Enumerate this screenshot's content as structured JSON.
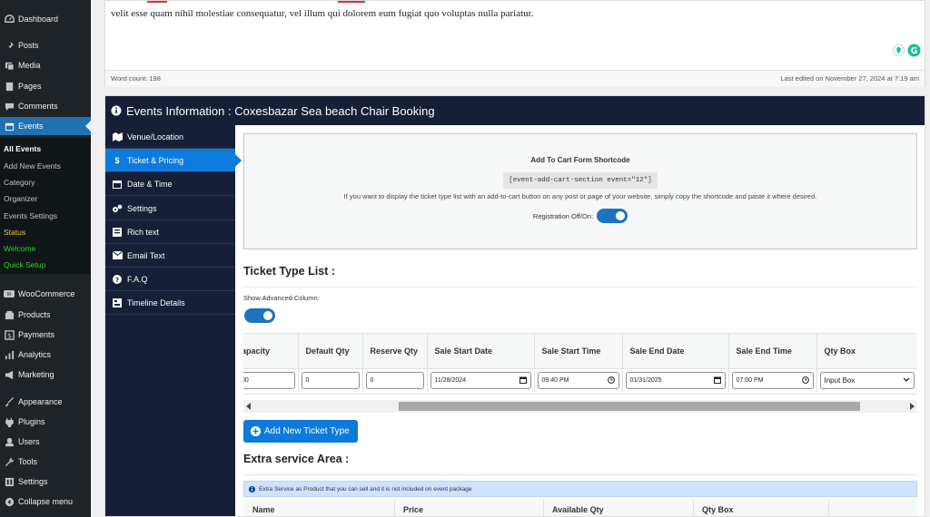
{
  "sidebar": {
    "items": [
      {
        "label": "Dashboard",
        "icon": "dashboard-icon"
      },
      {
        "label": "Posts",
        "icon": "pin-icon"
      },
      {
        "label": "Media",
        "icon": "media-icon"
      },
      {
        "label": "Pages",
        "icon": "pages-icon"
      },
      {
        "label": "Comments",
        "icon": "comments-icon"
      },
      {
        "label": "Events",
        "icon": "calendar-icon"
      },
      {
        "label": "WooCommerce",
        "icon": "woo-icon"
      },
      {
        "label": "Products",
        "icon": "products-icon"
      },
      {
        "label": "Payments",
        "icon": "payments-icon"
      },
      {
        "label": "Analytics",
        "icon": "analytics-icon"
      },
      {
        "label": "Marketing",
        "icon": "marketing-icon"
      },
      {
        "label": "Appearance",
        "icon": "brush-icon"
      },
      {
        "label": "Plugins",
        "icon": "plugin-icon"
      },
      {
        "label": "Users",
        "icon": "users-icon"
      },
      {
        "label": "Tools",
        "icon": "wrench-icon"
      },
      {
        "label": "Settings",
        "icon": "settings-icon"
      },
      {
        "label": "Collapse menu",
        "icon": "collapse-icon"
      }
    ],
    "events_submenu": [
      "All Events",
      "Add New Events",
      "Category",
      "Organizer",
      "Events Settings",
      "Status",
      "Welcome",
      "Quick Setup"
    ]
  },
  "editor": {
    "text": "velit esse quam nihil molestiae consequatur, vel illum qui dolorem eum fugiat quo voluptas nulla pariatur.",
    "word_count": "Word count: 198",
    "last_edited": "Last edited on November 27, 2024 at 7:19 am"
  },
  "events_box": {
    "title": "Events Information : Coxesbazar Sea beach Chair Booking",
    "tabs": [
      "Venue/Location",
      "Ticket & Pricing",
      "Date & Time",
      "Settings",
      "Rich text",
      "Email Text",
      "F.A.Q",
      "Timeline Details"
    ],
    "shortcode": {
      "heading": "Add To Cart Form Shortcode",
      "code": "[event-add-cart-section event=\"12\"]",
      "help": "If you want to display the ticket type list with an add-to-cart button on any post or page of your website, simply copy the shortcode and paste it where desired.",
      "registration_label": "Registration Off/On:"
    },
    "ticket_type": {
      "heading": "Ticket Type List :",
      "advanced_label": "Show Advanced Column:",
      "columns": [
        "apacity",
        "Default Qty",
        "Reserve Qty",
        "Sale Start Date",
        "Sale Start Time",
        "Sale End Date",
        "Sale End Time",
        "Qty Box"
      ],
      "row": {
        "capacity": "00",
        "default_qty": "0",
        "reserve_qty": "0",
        "sale_start_date": "11/28/2024",
        "sale_start_time": "09:40 PM",
        "sale_end_date": "01/31/2025",
        "sale_end_time": "07:00 PM",
        "qty_box": "Input Box"
      },
      "add_button": "Add New Ticket Type"
    },
    "extra_service": {
      "heading": "Extra service Area :",
      "info": "Extra Service as Product that you can sell and it is not included on event package",
      "columns": [
        "Name",
        "Price",
        "Available Qty",
        "Qty Box"
      ]
    }
  },
  "colors": {
    "sidebar_bg": "#1d2327",
    "accent": "#2271b1",
    "events_header": "#171e37",
    "tab_active": "#0d7bdc"
  }
}
